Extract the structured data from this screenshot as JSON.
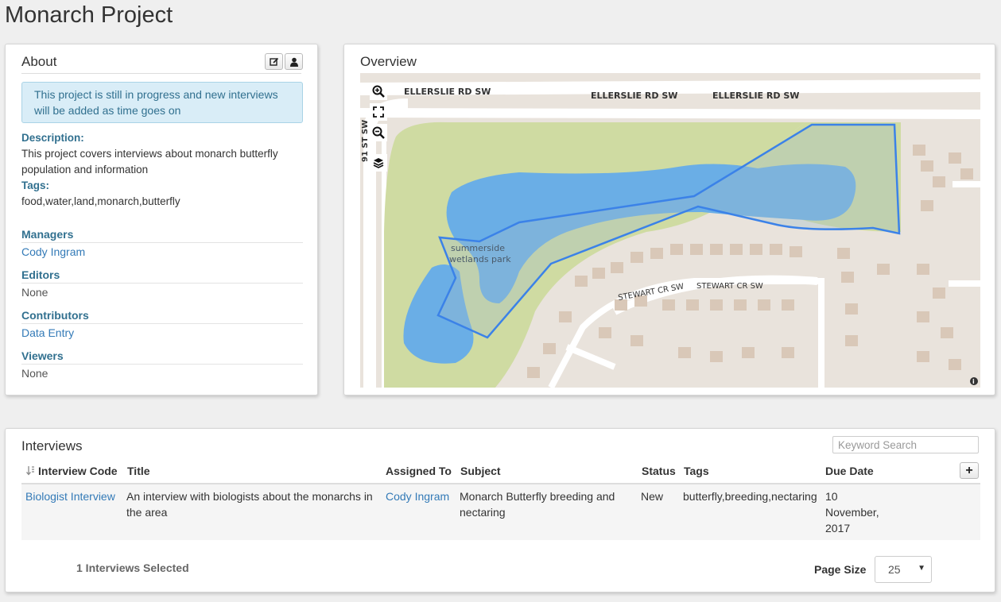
{
  "page": {
    "title": "Monarch Project"
  },
  "about": {
    "heading": "About",
    "alert": "This project is still in progress and new interviews will be added as time goes on",
    "description_label": "Description:",
    "description": "This project covers interviews about monarch butterfly population and information",
    "tags_label": "Tags:",
    "tags": "food,water,land,monarch,butterfly",
    "sections": [
      {
        "label": "Managers",
        "value": "Cody Ingram",
        "is_link": true
      },
      {
        "label": "Editors",
        "value": "None",
        "is_link": false
      },
      {
        "label": "Contributors",
        "value": "Data Entry",
        "is_link": true
      },
      {
        "label": "Viewers",
        "value": "None",
        "is_link": false
      }
    ],
    "edit_icon": "edit-icon",
    "user_icon": "user-icon"
  },
  "overview": {
    "heading": "Overview",
    "map": {
      "road_labels": {
        "ellerslie_1": "ELLERSLIE RD SW",
        "ellerslie_2": "ELLERSLIE RD SW",
        "ellerslie_3": "ELLERSLIE RD SW",
        "st91": "91 ST SW",
        "stewart_1": "STEWART CR SW",
        "stewart_2": "STEWART CR SW"
      },
      "park_label_1": "summerside",
      "park_label_2": "wetlands park",
      "controls": [
        "zoom-in-icon",
        "fullscreen-icon",
        "zoom-out-icon",
        "layers-icon"
      ],
      "colors": {
        "water": "#6aaee6",
        "park": "#cfdba2",
        "outline": "#3b82e8",
        "land": "#e9e3dc",
        "building": "#d9c8b8"
      }
    }
  },
  "interviews": {
    "heading": "Interviews",
    "search_placeholder": "Keyword Search",
    "columns": [
      "Interview Code",
      "Title",
      "Assigned To",
      "Subject",
      "Status",
      "Tags",
      "Due Date"
    ],
    "rows": [
      {
        "code": "Biologist Interview",
        "title": "An interview with biologists about the monarchs in the area",
        "assigned_to": "Cody Ingram",
        "subject": "Monarch Butterfly breeding and nectaring",
        "status": "New",
        "tags": "butterfly,breeding,nectaring",
        "due_date": "10 November, 2017"
      }
    ],
    "add_label": "+",
    "selected_text": "1 Interviews Selected",
    "page_size_label": "Page Size",
    "page_size_value": "25"
  }
}
